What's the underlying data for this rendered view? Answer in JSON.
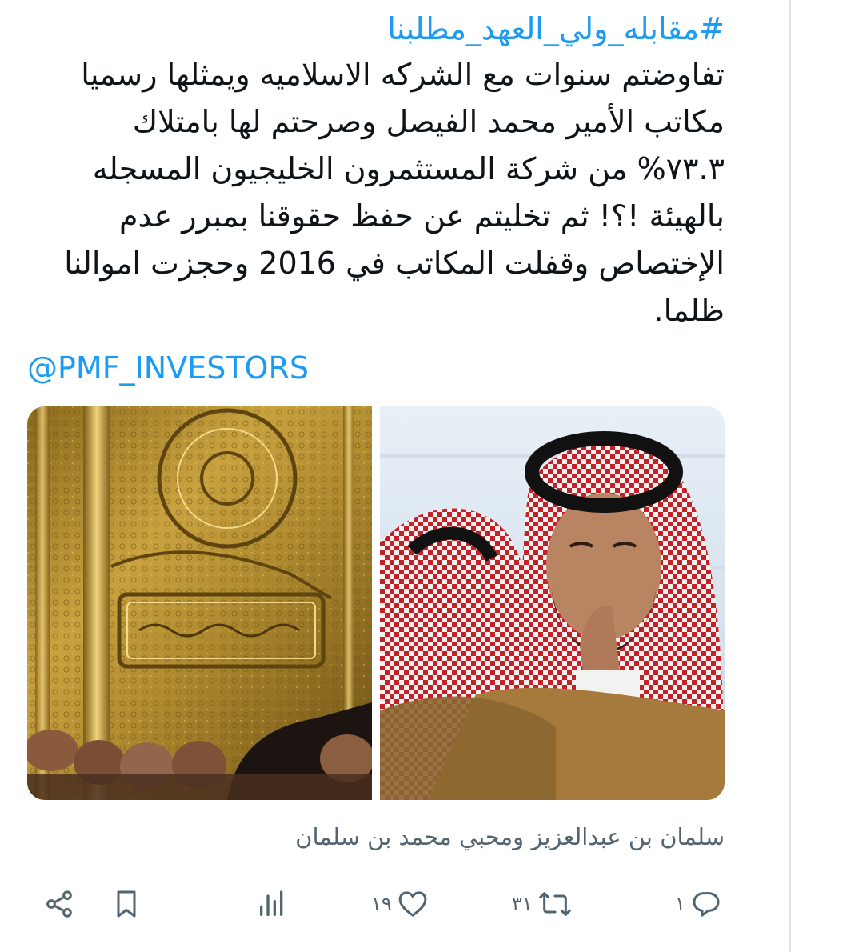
{
  "tweet": {
    "hashtag": "#مقابله_ولي_العهد_مطلبنا",
    "body_lines": [
      "تفاوضتم سنوات مع الشركه الاسلاميه ويمثلها رسميا",
      "مكاتب الأمير محمد الفيصل وصرحتم لها بامتلاك",
      "٧٣.٣% من شركة المستثمرون الخليجيون المسجله",
      "بالهيئة !؟! ثم تخليتم عن حفظ حقوقنا بمبرر عدم",
      "الإختصاص وقفلت المكاتب في 2016 وحجزت اموالنا",
      "ظلما."
    ],
    "mention": "@PMF_INVESTORS",
    "caption": "سلمان بن عبدالعزيز ومحبي محمد بن سلمان"
  },
  "actions": {
    "reply_count": "١",
    "retweet_count": "٣١",
    "like_count": "١٩"
  },
  "icons": {
    "reply": "reply-icon",
    "retweet": "retweet-icon",
    "like": "heart-icon",
    "views": "views-icon",
    "bookmark": "bookmark-icon",
    "share": "share-icon"
  },
  "colors": {
    "link": "#1d9bf0",
    "text": "#0f1419",
    "muted": "#536471"
  }
}
